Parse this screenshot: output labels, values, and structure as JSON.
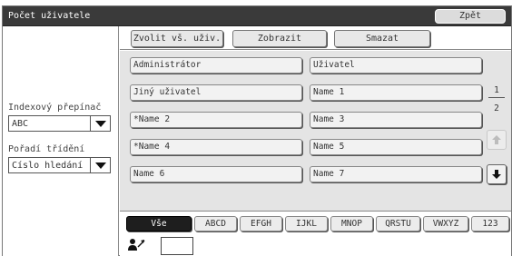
{
  "window": {
    "title": "Počet uživatele",
    "back_label": "Zpět"
  },
  "toolbar": {
    "select_all_label": "Zvolit vš. uživ.",
    "display_label": "Zobrazit",
    "delete_label": "Smazat"
  },
  "sidebar": {
    "index_label": "Indexový přepínač",
    "index_value": "ABC",
    "sort_label": "Pořadí třídění",
    "sort_value": "Číslo hledání"
  },
  "users": {
    "left": [
      "Administrátor",
      "Jiný uživatel",
      "*Name 2",
      "*Name 4",
      "Name 6"
    ],
    "right": [
      "Uživatel",
      "Name 1",
      "Name 3",
      "Name 5",
      "Name 7"
    ]
  },
  "pagination": {
    "current": "1",
    "total": "2"
  },
  "tabs": [
    "Vše",
    "ABCD",
    "EFGH",
    "IJKL",
    "MNOP",
    "QRSTU",
    "VWXYZ",
    "123"
  ],
  "icons": {
    "up": "arrow-up-icon",
    "down": "arrow-down-icon",
    "user_number": "user-number-icon",
    "dropdown": "chevron-down-icon"
  },
  "colors": {
    "titlebar": "#3a3a3a",
    "active_tab": "#1e1e1e",
    "list_background": "#e4e4e4"
  }
}
